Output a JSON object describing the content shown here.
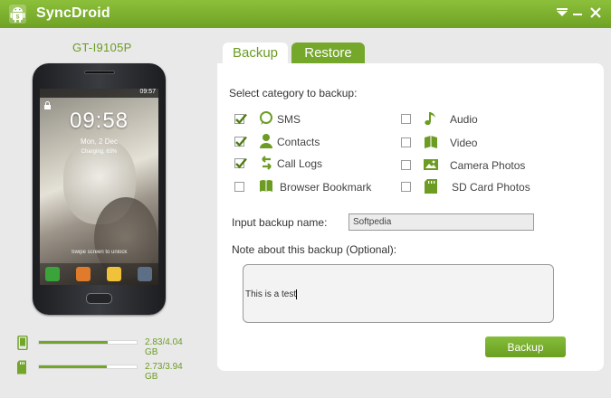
{
  "app": {
    "title": "SyncDroid"
  },
  "colors": {
    "accent": "#75a72b",
    "title_bar": "#7cb02f",
    "background": "#e9e9e9"
  },
  "icons": {
    "app_logo": "android-logo-icon",
    "window_menu": "menu-icon",
    "window_minimize": "minimize-icon",
    "window_close": "close-icon"
  },
  "device": {
    "name": "GT-I9105P",
    "screen": {
      "status_time": "09:57",
      "clock": "09:58",
      "date": "Mon, 2 Dec",
      "charging": "Charging, 63%",
      "swipe_hint": "Swipe screen to unlock"
    },
    "storage": [
      {
        "icon": "phone-storage-icon",
        "used_fraction": 0.7,
        "text": "2.83/4.04 GB"
      },
      {
        "icon": "sd-card-icon",
        "used_fraction": 0.69,
        "text": "2.73/3.94 GB"
      }
    ]
  },
  "tabs": [
    {
      "label": "Backup",
      "active": true
    },
    {
      "label": "Restore",
      "active": false
    }
  ],
  "backup": {
    "section_title": "Select category to backup:",
    "categories": [
      {
        "label": "SMS",
        "checked": true,
        "icon": "sms-bubble-icon"
      },
      {
        "label": "Contacts",
        "checked": true,
        "icon": "contact-person-icon"
      },
      {
        "label": "Call Logs",
        "checked": true,
        "icon": "call-log-arrows-icon"
      },
      {
        "label": "Browser Bookmark",
        "checked": false,
        "icon": "bookmark-book-icon"
      },
      {
        "label": "Audio",
        "checked": false,
        "icon": "music-note-icon"
      },
      {
        "label": "Video",
        "checked": false,
        "icon": "video-film-icon"
      },
      {
        "label": "Camera Photos",
        "checked": false,
        "icon": "photo-icon"
      },
      {
        "label": "SD Card Photos",
        "checked": false,
        "icon": "sd-card-photo-icon"
      }
    ],
    "name_label": "Input backup name:",
    "name_value": "Softpedia",
    "note_label": "Note about this backup (Optional):",
    "note_value": "This is a test",
    "button_label": "Backup"
  }
}
